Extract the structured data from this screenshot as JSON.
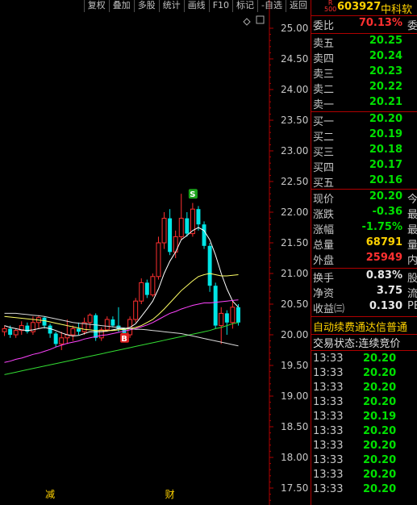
{
  "toolbar": {
    "items": [
      "复权",
      "叠加",
      "多股",
      "统计",
      "画线",
      "F10",
      "标记",
      "-自选",
      "返回"
    ]
  },
  "header": {
    "code_badge_top": "R",
    "code_badge_bottom": "500",
    "code": "603927",
    "name": "中科软"
  },
  "weibi": {
    "label": "委比",
    "value": "70.13%",
    "tail": "委"
  },
  "asks": [
    {
      "label": "卖五",
      "price": "20.25"
    },
    {
      "label": "卖四",
      "price": "20.24"
    },
    {
      "label": "卖三",
      "price": "20.23"
    },
    {
      "label": "卖二",
      "price": "20.22"
    },
    {
      "label": "卖一",
      "price": "20.21"
    }
  ],
  "bids": [
    {
      "label": "买一",
      "price": "20.20"
    },
    {
      "label": "买二",
      "price": "20.19"
    },
    {
      "label": "买三",
      "price": "20.18"
    },
    {
      "label": "买四",
      "price": "20.17"
    },
    {
      "label": "买五",
      "price": "20.16"
    }
  ],
  "stats": [
    {
      "label": "现价",
      "value": "20.20",
      "color": "#00e000",
      "tail": "今"
    },
    {
      "label": "涨跌",
      "value": "-0.36",
      "color": "#00e000",
      "tail": "最"
    },
    {
      "label": "涨幅",
      "value": "-1.75%",
      "color": "#00e000",
      "tail": "最"
    },
    {
      "label": "总量",
      "value": "68791",
      "color": "#ffd200",
      "tail": "量"
    },
    {
      "label": "外盘",
      "value": "25949",
      "color": "#ff3030",
      "tail": "内"
    }
  ],
  "stats2": [
    {
      "label": "换手",
      "value": "0.83%",
      "tail": "股"
    },
    {
      "label": "净资",
      "value": "3.75",
      "tail": "流"
    },
    {
      "label": "收益㈢",
      "value": "0.130",
      "tail": "PE"
    }
  ],
  "notice": "自动续费通达信普通",
  "trade_status": "交易状态:连续竞价",
  "ticks": [
    {
      "time": "13:33",
      "price": "20.20"
    },
    {
      "time": "13:33",
      "price": "20.20"
    },
    {
      "time": "13:33",
      "price": "20.20"
    },
    {
      "time": "13:33",
      "price": "20.20"
    },
    {
      "time": "13:33",
      "price": "20.19"
    },
    {
      "time": "13:33",
      "price": "20.20"
    },
    {
      "time": "13:33",
      "price": "20.20"
    },
    {
      "time": "13:33",
      "price": "20.20"
    },
    {
      "time": "13:33",
      "price": "20.20"
    },
    {
      "time": "13:33",
      "price": "20.20"
    }
  ],
  "chart_data": {
    "type": "candlestick",
    "y_ticks": [
      "25.00",
      "24.50",
      "24.00",
      "23.50",
      "23.00",
      "22.50",
      "22.00",
      "21.50",
      "21.00",
      "20.50",
      "20.00",
      "19.50",
      "19.00",
      "18.50",
      "18.00",
      "17.50"
    ],
    "ylim": [
      17.3,
      25.1
    ],
    "candles": [
      {
        "o": 20.05,
        "c": 20.1,
        "h": 20.15,
        "l": 19.98
      },
      {
        "o": 20.1,
        "c": 20.0,
        "h": 20.15,
        "l": 19.95
      },
      {
        "o": 20.0,
        "c": 20.07,
        "h": 20.1,
        "l": 19.95
      },
      {
        "o": 20.07,
        "c": 20.15,
        "h": 20.22,
        "l": 20.0
      },
      {
        "o": 20.15,
        "c": 20.05,
        "h": 20.2,
        "l": 20.02
      },
      {
        "o": 20.05,
        "c": 20.2,
        "h": 20.3,
        "l": 20.0
      },
      {
        "o": 20.2,
        "c": 20.28,
        "h": 20.32,
        "l": 20.1
      },
      {
        "o": 20.28,
        "c": 20.15,
        "h": 20.3,
        "l": 20.1
      },
      {
        "o": 20.15,
        "c": 20.02,
        "h": 20.18,
        "l": 19.95
      },
      {
        "o": 20.02,
        "c": 19.85,
        "h": 20.05,
        "l": 19.8
      },
      {
        "o": 19.85,
        "c": 19.95,
        "h": 20.05,
        "l": 19.75
      },
      {
        "o": 19.95,
        "c": 20.0,
        "h": 20.25,
        "l": 19.85
      },
      {
        "o": 20.0,
        "c": 20.1,
        "h": 20.15,
        "l": 19.9
      },
      {
        "o": 20.1,
        "c": 20.05,
        "h": 20.2,
        "l": 20.0
      },
      {
        "o": 20.05,
        "c": 20.2,
        "h": 20.28,
        "l": 20.0
      },
      {
        "o": 20.2,
        "c": 20.32,
        "h": 20.35,
        "l": 20.1
      },
      {
        "o": 20.32,
        "c": 19.95,
        "h": 20.35,
        "l": 19.9
      },
      {
        "o": 19.95,
        "c": 20.08,
        "h": 20.12,
        "l": 19.9
      },
      {
        "o": 20.08,
        "c": 20.25,
        "h": 20.3,
        "l": 20.05
      },
      {
        "o": 20.25,
        "c": 20.15,
        "h": 20.3,
        "l": 20.12
      },
      {
        "o": 20.15,
        "c": 20.1,
        "h": 20.45,
        "l": 20.05
      },
      {
        "o": 20.1,
        "c": 20.0,
        "h": 20.12,
        "l": 19.95
      },
      {
        "o": 20.0,
        "c": 20.25,
        "h": 20.3,
        "l": 19.95
      },
      {
        "o": 20.25,
        "c": 20.55,
        "h": 20.6,
        "l": 20.2
      },
      {
        "o": 20.55,
        "c": 20.85,
        "h": 20.92,
        "l": 20.5
      },
      {
        "o": 20.85,
        "c": 20.65,
        "h": 20.9,
        "l": 20.6
      },
      {
        "o": 20.65,
        "c": 20.95,
        "h": 21.0,
        "l": 20.62
      },
      {
        "o": 20.95,
        "c": 21.5,
        "h": 21.6,
        "l": 20.9
      },
      {
        "o": 21.5,
        "c": 21.9,
        "h": 22.0,
        "l": 21.4
      },
      {
        "o": 21.9,
        "c": 21.35,
        "h": 22.05,
        "l": 21.3
      },
      {
        "o": 21.35,
        "c": 21.6,
        "h": 21.7,
        "l": 21.25
      },
      {
        "o": 21.6,
        "c": 21.9,
        "h": 22.3,
        "l": 21.55
      },
      {
        "o": 21.9,
        "c": 21.65,
        "h": 22.0,
        "l": 21.6
      },
      {
        "o": 21.65,
        "c": 22.05,
        "h": 22.15,
        "l": 21.6
      },
      {
        "o": 22.05,
        "c": 21.8,
        "h": 22.1,
        "l": 21.7
      },
      {
        "o": 21.8,
        "c": 21.45,
        "h": 21.85,
        "l": 21.4
      },
      {
        "o": 21.45,
        "c": 20.8,
        "h": 21.5,
        "l": 20.7
      },
      {
        "o": 20.8,
        "c": 20.15,
        "h": 20.85,
        "l": 20.1
      },
      {
        "o": 20.15,
        "c": 20.35,
        "h": 20.45,
        "l": 19.85
      },
      {
        "o": 20.35,
        "c": 20.2,
        "h": 20.4,
        "l": 20.0
      },
      {
        "o": 20.2,
        "c": 20.45,
        "h": 20.55,
        "l": 20.1
      },
      {
        "o": 20.45,
        "c": 20.2,
        "h": 20.5,
        "l": 20.15
      }
    ],
    "markers": [
      {
        "text": "S",
        "index": 33,
        "price": 22.3,
        "color": "#1aa31a"
      },
      {
        "text": "B",
        "index": 21,
        "price": 19.95,
        "color": "#e02020"
      }
    ],
    "bottom_labels": [
      {
        "text": "减",
        "index": 8,
        "color": "#ffd200"
      },
      {
        "text": "财",
        "index": 29,
        "color": "#ffd200"
      }
    ],
    "ma_lines": [
      {
        "name": "",
        "color": "#ffffff",
        "values": [
          20.15,
          20.12,
          20.1,
          20.08,
          20.07,
          20.08,
          20.1,
          20.12,
          20.1,
          20.07,
          20.03,
          20.0,
          19.98,
          19.99,
          20.02,
          20.05,
          20.05,
          20.05,
          20.06,
          20.08,
          20.1,
          20.1,
          20.12,
          20.18,
          20.3,
          20.42,
          20.55,
          20.75,
          21.0,
          21.2,
          21.35,
          21.55,
          21.62,
          21.7,
          21.75,
          21.7,
          21.55,
          21.3,
          21.0,
          20.75,
          20.55,
          20.45
        ]
      },
      {
        "name": "",
        "color": "#ffff66",
        "values": [
          20.3,
          20.29,
          20.28,
          20.27,
          20.26,
          20.25,
          20.24,
          20.23,
          20.21,
          20.19,
          20.17,
          20.15,
          20.13,
          20.11,
          20.09,
          20.08,
          20.07,
          20.07,
          20.07,
          20.07,
          20.08,
          20.09,
          20.1,
          20.12,
          20.15,
          20.2,
          20.25,
          20.33,
          20.42,
          20.52,
          20.62,
          20.72,
          20.8,
          20.88,
          20.95,
          20.98,
          21.0,
          20.98,
          20.96,
          20.96,
          20.97,
          20.98
        ]
      },
      {
        "name": "",
        "color": "#ff44ff",
        "values": [
          19.55,
          19.57,
          19.6,
          19.62,
          19.65,
          19.68,
          19.7,
          19.73,
          19.76,
          19.8,
          19.83,
          19.86,
          19.88,
          19.9,
          19.93,
          19.95,
          19.97,
          19.99,
          20.0,
          20.02,
          20.04,
          20.06,
          20.08,
          20.1,
          20.13,
          20.16,
          20.2,
          20.25,
          20.3,
          20.35,
          20.38,
          20.42,
          20.45,
          20.48,
          20.5,
          20.52,
          20.52,
          20.53,
          20.54,
          20.55,
          20.56,
          20.57
        ]
      },
      {
        "name": "",
        "color": "#33dd33",
        "values": [
          19.35,
          19.37,
          19.39,
          19.41,
          19.43,
          19.45,
          19.47,
          19.49,
          19.51,
          19.53,
          19.55,
          19.57,
          19.59,
          19.61,
          19.63,
          19.65,
          19.67,
          19.69,
          19.71,
          19.73,
          19.75,
          19.77,
          19.79,
          19.81,
          19.83,
          19.85,
          19.87,
          19.89,
          19.91,
          19.93,
          19.95,
          19.97,
          19.99,
          20.01,
          20.03,
          20.05,
          20.07,
          20.1,
          20.12,
          20.15,
          20.18,
          20.2
        ]
      },
      {
        "name": "",
        "color": "#d8d8d8",
        "values": [
          20.35,
          20.35,
          20.35,
          20.34,
          20.33,
          20.32,
          20.31,
          20.3,
          20.28,
          20.26,
          20.24,
          20.22,
          20.2,
          20.19,
          20.18,
          20.17,
          20.16,
          20.15,
          20.14,
          20.13,
          20.12,
          20.11,
          20.1,
          20.09,
          20.09,
          20.08,
          20.07,
          20.06,
          20.05,
          20.04,
          20.03,
          20.02,
          20.0,
          19.98,
          19.96,
          19.94,
          19.92,
          19.9,
          19.88,
          19.86,
          19.84,
          19.82
        ]
      }
    ]
  }
}
